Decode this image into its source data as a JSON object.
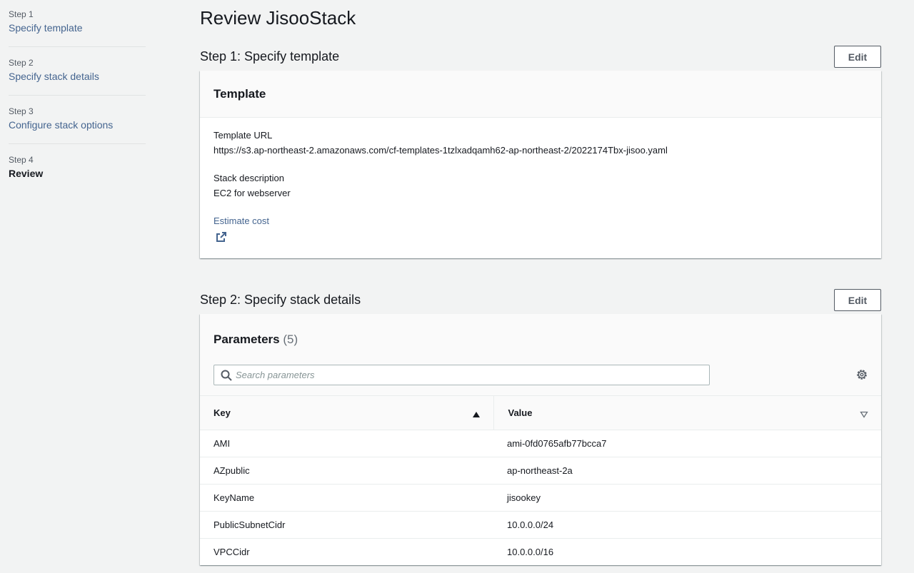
{
  "sidebar": {
    "steps": [
      {
        "number": "Step 1",
        "label": "Specify template"
      },
      {
        "number": "Step 2",
        "label": "Specify stack details"
      },
      {
        "number": "Step 3",
        "label": "Configure stack options"
      },
      {
        "number": "Step 4",
        "label": "Review"
      }
    ]
  },
  "page": {
    "title": "Review JisooStack"
  },
  "step1": {
    "title": "Step 1: Specify template",
    "edit_label": "Edit",
    "card_title": "Template",
    "template_url_label": "Template URL",
    "template_url_value": "https://s3.ap-northeast-2.amazonaws.com/cf-templates-1tzlxadqamh62-ap-northeast-2/2022174Tbx-jisoo.yaml",
    "description_label": "Stack description",
    "description_value": "EC2 for webserver",
    "estimate_cost_label": "Estimate cost"
  },
  "step2": {
    "title": "Step 2: Specify stack details",
    "edit_label": "Edit",
    "card_title": "Parameters",
    "count": "(5)",
    "search_placeholder": "Search parameters",
    "columns": {
      "key": "Key",
      "value": "Value"
    },
    "rows": [
      {
        "key": "AMI",
        "value": "ami-0fd0765afb77bcca7"
      },
      {
        "key": "AZpublic",
        "value": "ap-northeast-2a"
      },
      {
        "key": "KeyName",
        "value": "jisookey"
      },
      {
        "key": "PublicSubnetCidr",
        "value": "10.0.0.0/24"
      },
      {
        "key": "VPCCidr",
        "value": "10.0.0.0/16"
      }
    ]
  },
  "colors": {
    "link": "#44648f",
    "background": "#f2f3f3",
    "text": "#16191f",
    "secondary_text": "#545b64"
  },
  "icons": [
    "external-link-icon",
    "search-icon",
    "gear-icon",
    "sort-ascending-icon",
    "sort-descending-icon"
  ]
}
